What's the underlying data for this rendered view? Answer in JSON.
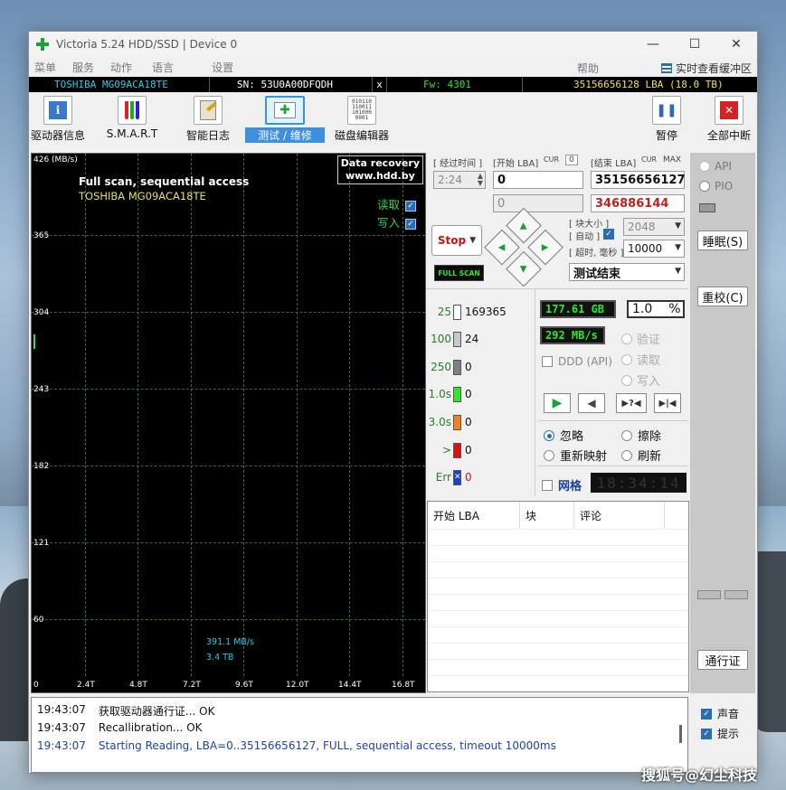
{
  "window": {
    "title": "Victoria 5.24 HDD/SSD | Device 0",
    "minimize": "—",
    "maximize": "☐",
    "close": "✕"
  },
  "menu": {
    "items": [
      "菜单",
      "服务",
      "动作",
      "语言",
      "设置"
    ],
    "help": "帮助",
    "buffer": "实时查看缓冲区"
  },
  "infobar": {
    "model": "TOSHIBA MG09ACA18TE",
    "serial": "SN: 53U0A00DFQDH",
    "close": "x",
    "firmware": "Fw: 4301",
    "lba": "35156656128 LBA (18.0 TB)",
    "colors": {
      "model": "#23d0e6",
      "firmware": "#2de82d",
      "lba": "#f5e43a"
    }
  },
  "toolbar": {
    "drive_info": "驱动器信息",
    "smart": "S.M.A.R.T",
    "smart_log": "智能日志",
    "test": "测试 / 维修",
    "disk_editor": "磁盘编辑器",
    "pause": "暂停",
    "abort": "全部中断"
  },
  "graph": {
    "y_top": "426 (MB/s)",
    "y_ticks": [
      "365",
      "304",
      "243",
      "182",
      "121",
      "60"
    ],
    "x_ticks": [
      "0",
      "2.4T",
      "4.8T",
      "7.2T",
      "9.6T",
      "12.0T",
      "14.4T",
      "16.8T"
    ],
    "title": "Full scan, sequential access",
    "subtitle": "TOSHIBA MG09ACA18TE",
    "promo_line1": "Data recovery",
    "promo_line2": "www.hdd.by",
    "read_label": "读取",
    "write_label": "写入",
    "current_speed": "391.1 MB/s",
    "current_pos": "3.4 TB"
  },
  "controls": {
    "elapsed_label": "[ 经过时间 ]",
    "elapsed_value": "2:24",
    "start_lba_label": "[开始 LBA]",
    "cur_label": "CUR",
    "start_cur_value": "0",
    "end_lba_label": "[结束 LBA]",
    "max_label": "MAX",
    "start_lba": "0",
    "end_lba": "35156656127",
    "start_lba2": "0",
    "current_lba": "346886144",
    "stop": "Stop",
    "full_scan": "FULL SCAN",
    "block_size_label": "[ 块大小 ]",
    "auto_label": "[ 自动 ]",
    "block_size": "2048",
    "timeout_label": "[ 超时, 毫秒 ]",
    "timeout": "10000",
    "status": "测试结束"
  },
  "histogram": [
    {
      "label": "25",
      "value": "169365",
      "color": "#ffffff"
    },
    {
      "label": "100",
      "value": "24",
      "color": "#c8c8c8"
    },
    {
      "label": "250",
      "value": "0",
      "color": "#808080"
    },
    {
      "label": "1.0s",
      "value": "0",
      "color": "#2de82d"
    },
    {
      "label": "3.0s",
      "value": "0",
      "color": "#f08020"
    },
    {
      "label": ">",
      "value": "0",
      "color": "#e01010"
    },
    {
      "label": "Err",
      "value": "0",
      "color": "#1a3fd0"
    }
  ],
  "stats": {
    "scanned": "177.61 GB",
    "percent": "1.0",
    "percent_sign": "%",
    "speed": "292 MB/s",
    "ddd": "DDD (API)",
    "verify": "验证",
    "read": "读取",
    "write": "写入",
    "ignore": "忽略",
    "erase": "擦除",
    "remap": "重新映射",
    "refresh": "刷新",
    "grid": "网格",
    "clock": "18:34:14"
  },
  "table": {
    "headers": [
      "开始 LBA",
      "块",
      "评论"
    ]
  },
  "right_panel": {
    "api": "API",
    "pio": "PIO",
    "sleep": "睡眠(S)",
    "recal": "重校(C)",
    "passport": "通行证"
  },
  "log": [
    {
      "time": "19:43:07",
      "msg": "获取驱动器通行证... OK"
    },
    {
      "time": "19:43:07",
      "msg": "Recallibration... OK"
    },
    {
      "time": "19:43:07",
      "msg": "Starting Reading, LBA=0..35156656127, FULL, sequential access, timeout 10000ms"
    }
  ],
  "log_options": {
    "sound": "声音",
    "hints": "提示"
  },
  "watermark": "搜狐号@幻尘科技"
}
